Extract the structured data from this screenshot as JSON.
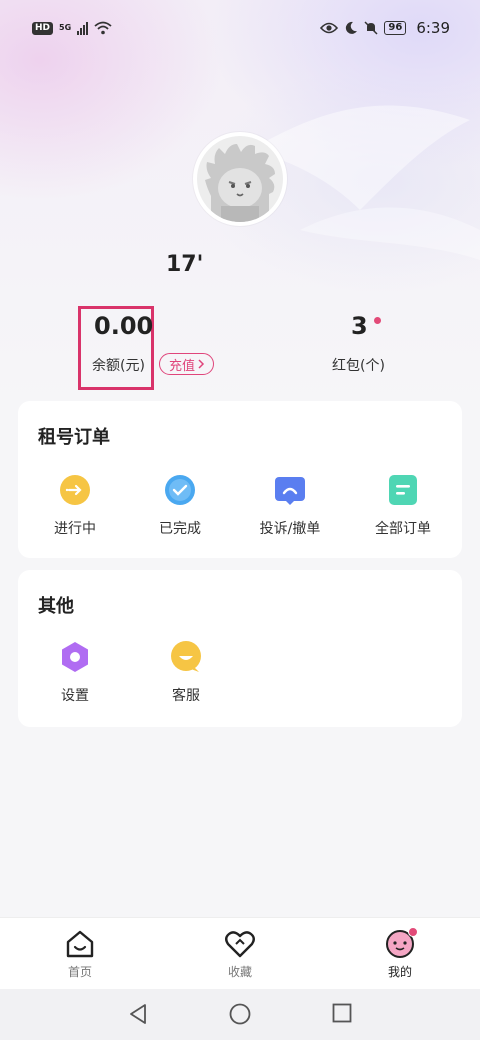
{
  "status_bar": {
    "hd": "HD",
    "network": "5G",
    "battery": "96",
    "time": "6:39"
  },
  "profile": {
    "username": "17'",
    "avatar_icon": "hedgehog-avatar-icon"
  },
  "stats": {
    "balance_value": "0.00",
    "balance_label": "余额(元)",
    "recharge_label": "充值",
    "redpack_value": "3",
    "redpack_label": "红包(个)"
  },
  "orders": {
    "title": "租号订单",
    "items": [
      {
        "label": "进行中",
        "icon": "in-progress-icon",
        "color": "#f6c544"
      },
      {
        "label": "已完成",
        "icon": "check-icon",
        "color": "#4aa8f0"
      },
      {
        "label": "投诉/撤单",
        "icon": "complaint-icon",
        "color": "#5a7ef0"
      },
      {
        "label": "全部订单",
        "icon": "all-orders-icon",
        "color": "#4fd6b4"
      }
    ]
  },
  "other": {
    "title": "其他",
    "items": [
      {
        "label": "设置",
        "icon": "settings-icon",
        "color": "#b06cf2"
      },
      {
        "label": "客服",
        "icon": "customer-service-icon",
        "color": "#f6c544"
      }
    ]
  },
  "tabbar": {
    "items": [
      {
        "label": "首页",
        "icon": "home-icon"
      },
      {
        "label": "收藏",
        "icon": "heart-icon"
      },
      {
        "label": "我的",
        "icon": "profile-icon"
      }
    ]
  },
  "colors": {
    "accent": "#e0457b",
    "highlight_box": "#d9336a"
  }
}
